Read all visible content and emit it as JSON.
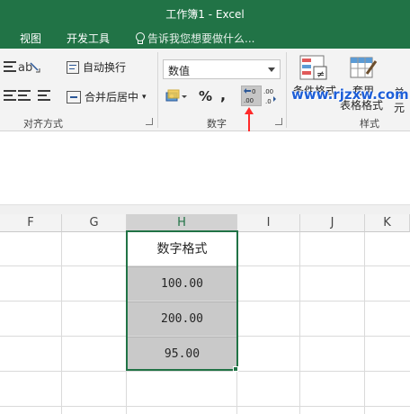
{
  "window": {
    "title": "工作簿1 - Excel"
  },
  "tabs": [
    {
      "label": "视图"
    },
    {
      "label": "开发工具"
    }
  ],
  "tell_me": "告诉我您想要做什么...",
  "ribbon": {
    "alignment": {
      "wrap_text": "自动换行",
      "merge_center": "合并后居中",
      "group_label": "对齐方式"
    },
    "number": {
      "format_value": "数值",
      "percent": "%",
      "comma": ",",
      "group_label": "数字"
    },
    "styles": {
      "conditional_format": "条件格式",
      "table_format": "表格格式",
      "cell_styles": "单元",
      "use": "套用",
      "group_label": "样式"
    }
  },
  "watermark": "www.rjzxw.com",
  "columns": [
    "F",
    "G",
    "H",
    "I",
    "J",
    "K"
  ],
  "selected_column": "H",
  "cells": {
    "header": "数字格式",
    "values": [
      "100.00",
      "200.00",
      "95.00"
    ]
  },
  "colors": {
    "accent": "#217346",
    "selection_fill": "#c9c9c9",
    "watermark": "#1e5fd8",
    "pointer_arrow": "#ff2a2a"
  }
}
